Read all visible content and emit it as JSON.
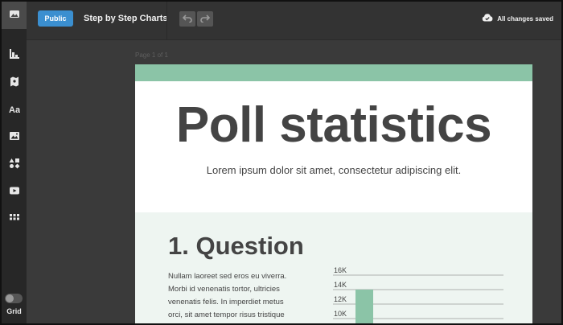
{
  "topbar": {
    "visibility_label": "Public",
    "document_title": "Step by Step Charts",
    "save_status": "All changes saved"
  },
  "sidebar": {
    "items": [
      {
        "icon": "image-landscape-icon",
        "active": true
      },
      {
        "icon": "bar-chart-icon",
        "active": false
      },
      {
        "icon": "map-icon",
        "active": false
      },
      {
        "icon": "text-icon",
        "active": false
      },
      {
        "icon": "photo-icon",
        "active": false
      },
      {
        "icon": "shapes-icon",
        "active": false
      },
      {
        "icon": "video-icon",
        "active": false
      },
      {
        "icon": "grid-apps-icon",
        "active": false
      }
    ],
    "grid_label": "Grid"
  },
  "canvas": {
    "page_label": "Page 1 of 1"
  },
  "document": {
    "title": "Poll statistics",
    "subtitle": "Lorem ipsum dolor sit amet, consectetur adipiscing elit.",
    "section_title": "1. Question",
    "section_lines": [
      "Nullam laoreet sed eros eu viverra.",
      "Morbi id venenatis tortor, ultricies",
      "venenatis felis. In imperdiet metus",
      "orci, sit amet tempor risus tristique"
    ]
  },
  "colors": {
    "accent_green": "#8bc4a7",
    "public_blue": "#3b8fd0"
  },
  "chart_data": {
    "type": "bar",
    "categories": [
      ""
    ],
    "values": [
      14000
    ],
    "ytick_labels": [
      "16K",
      "14K",
      "12K",
      "10K"
    ],
    "yticks": [
      16000,
      14000,
      12000,
      10000
    ],
    "ylim": [
      9000,
      16000
    ],
    "grid": true
  }
}
